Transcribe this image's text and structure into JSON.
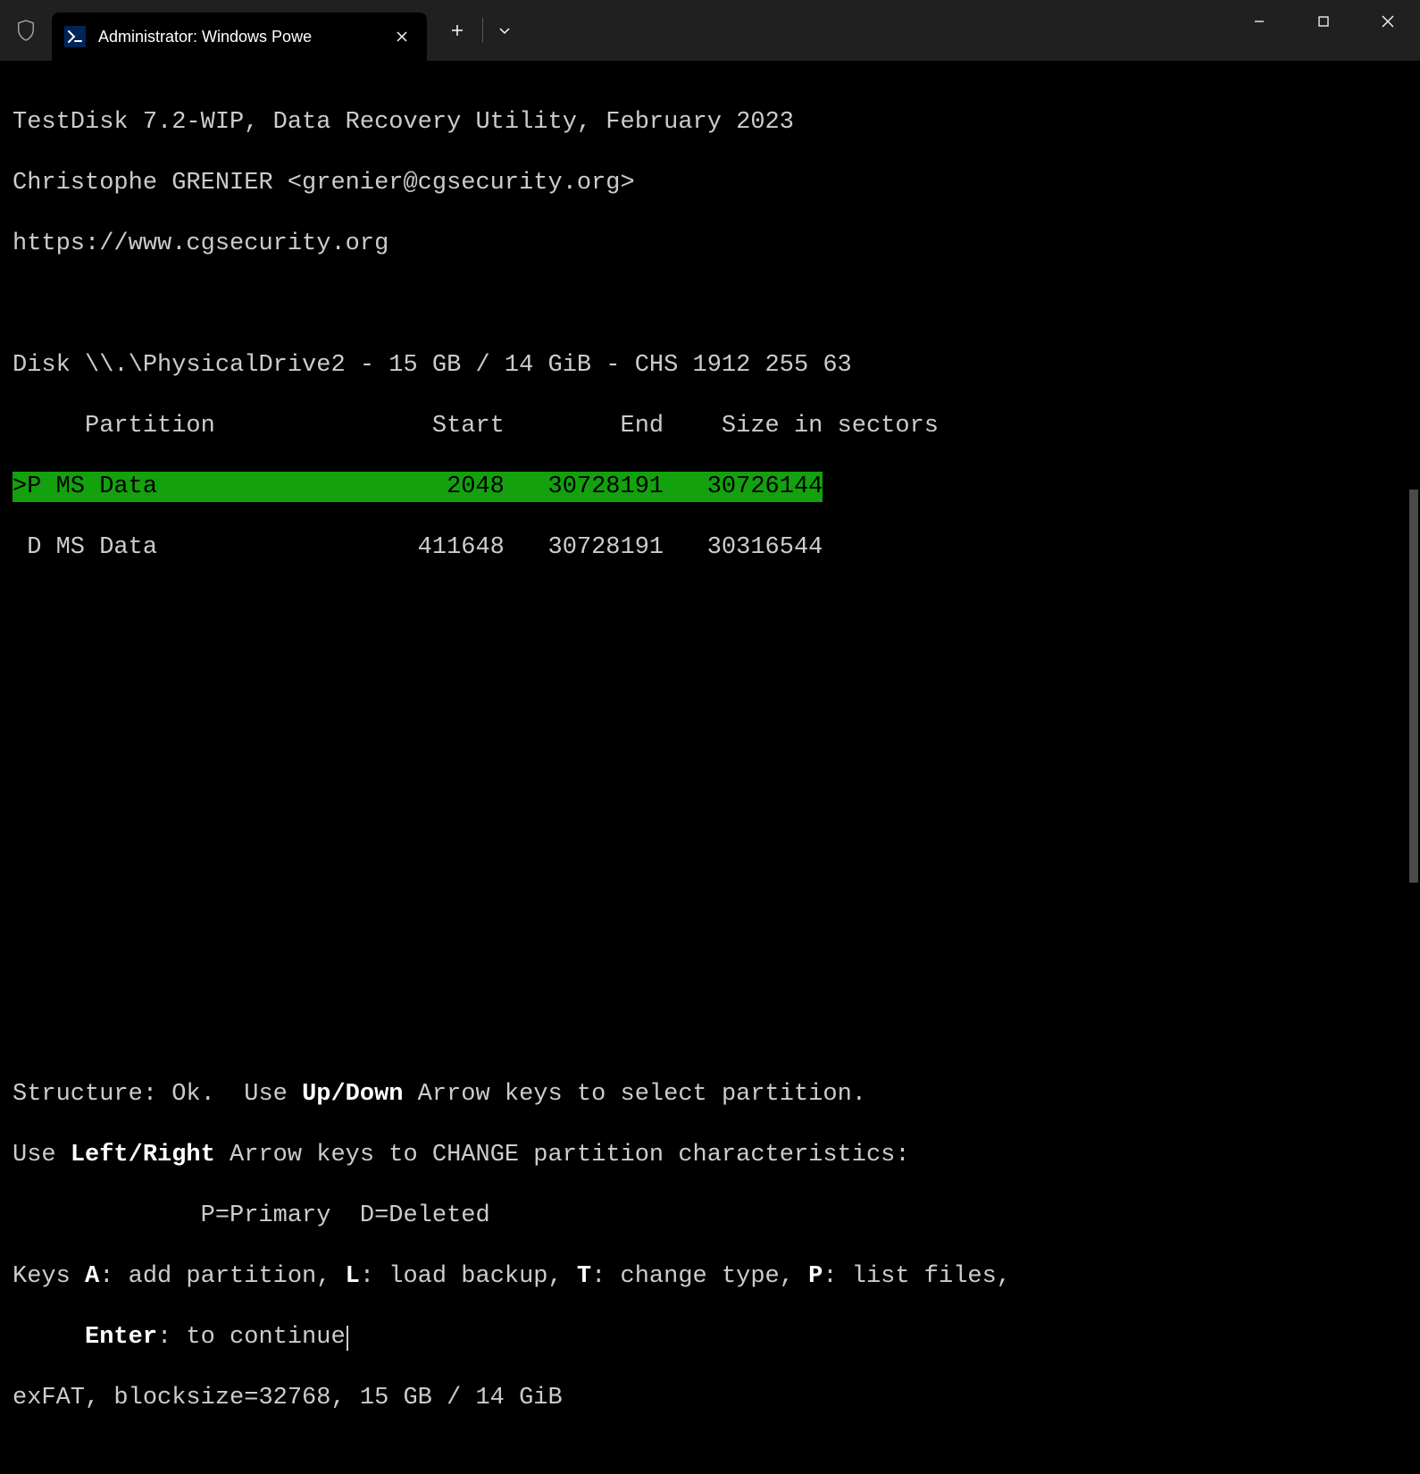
{
  "window": {
    "tab_title": "Administrator: Windows Powe"
  },
  "terminal": {
    "header_line1": "TestDisk 7.2-WIP, Data Recovery Utility, February 2023",
    "header_line2": "Christophe GRENIER <grenier@cgsecurity.org>",
    "header_line3": "https://www.cgsecurity.org",
    "disk_line": "Disk \\\\.\\PhysicalDrive2 - 15 GB / 14 GiB - CHS 1912 255 63",
    "table_header": "     Partition               Start        End    Size in sectors",
    "partition_selected": ">P MS Data                    2048   30728191   30726144",
    "partition_other": " D MS Data                  411648   30728191   30316544",
    "structure_pre": "Structure: Ok.  Use ",
    "updown": "Up/Down",
    "structure_post": " Arrow keys to select partition.",
    "change_pre": "Use ",
    "leftright": "Left/Right",
    "change_post": " Arrow keys to CHANGE partition characteristics:",
    "legend": "             P=Primary  D=Deleted",
    "keys_line1_pre": "Keys ",
    "keys_a": "A",
    "keys_line1_a": ": add partition, ",
    "keys_l": "L",
    "keys_line1_l": ": load backup, ",
    "keys_t": "T",
    "keys_line1_t": ": change type, ",
    "keys_p": "P",
    "keys_line1_p": ": list files,",
    "keys_line2_indent": "     ",
    "enter": "Enter",
    "keys_line2": ": to continue",
    "fs_line": "exFAT, blocksize=32768, 15 GB / 14 GiB"
  }
}
